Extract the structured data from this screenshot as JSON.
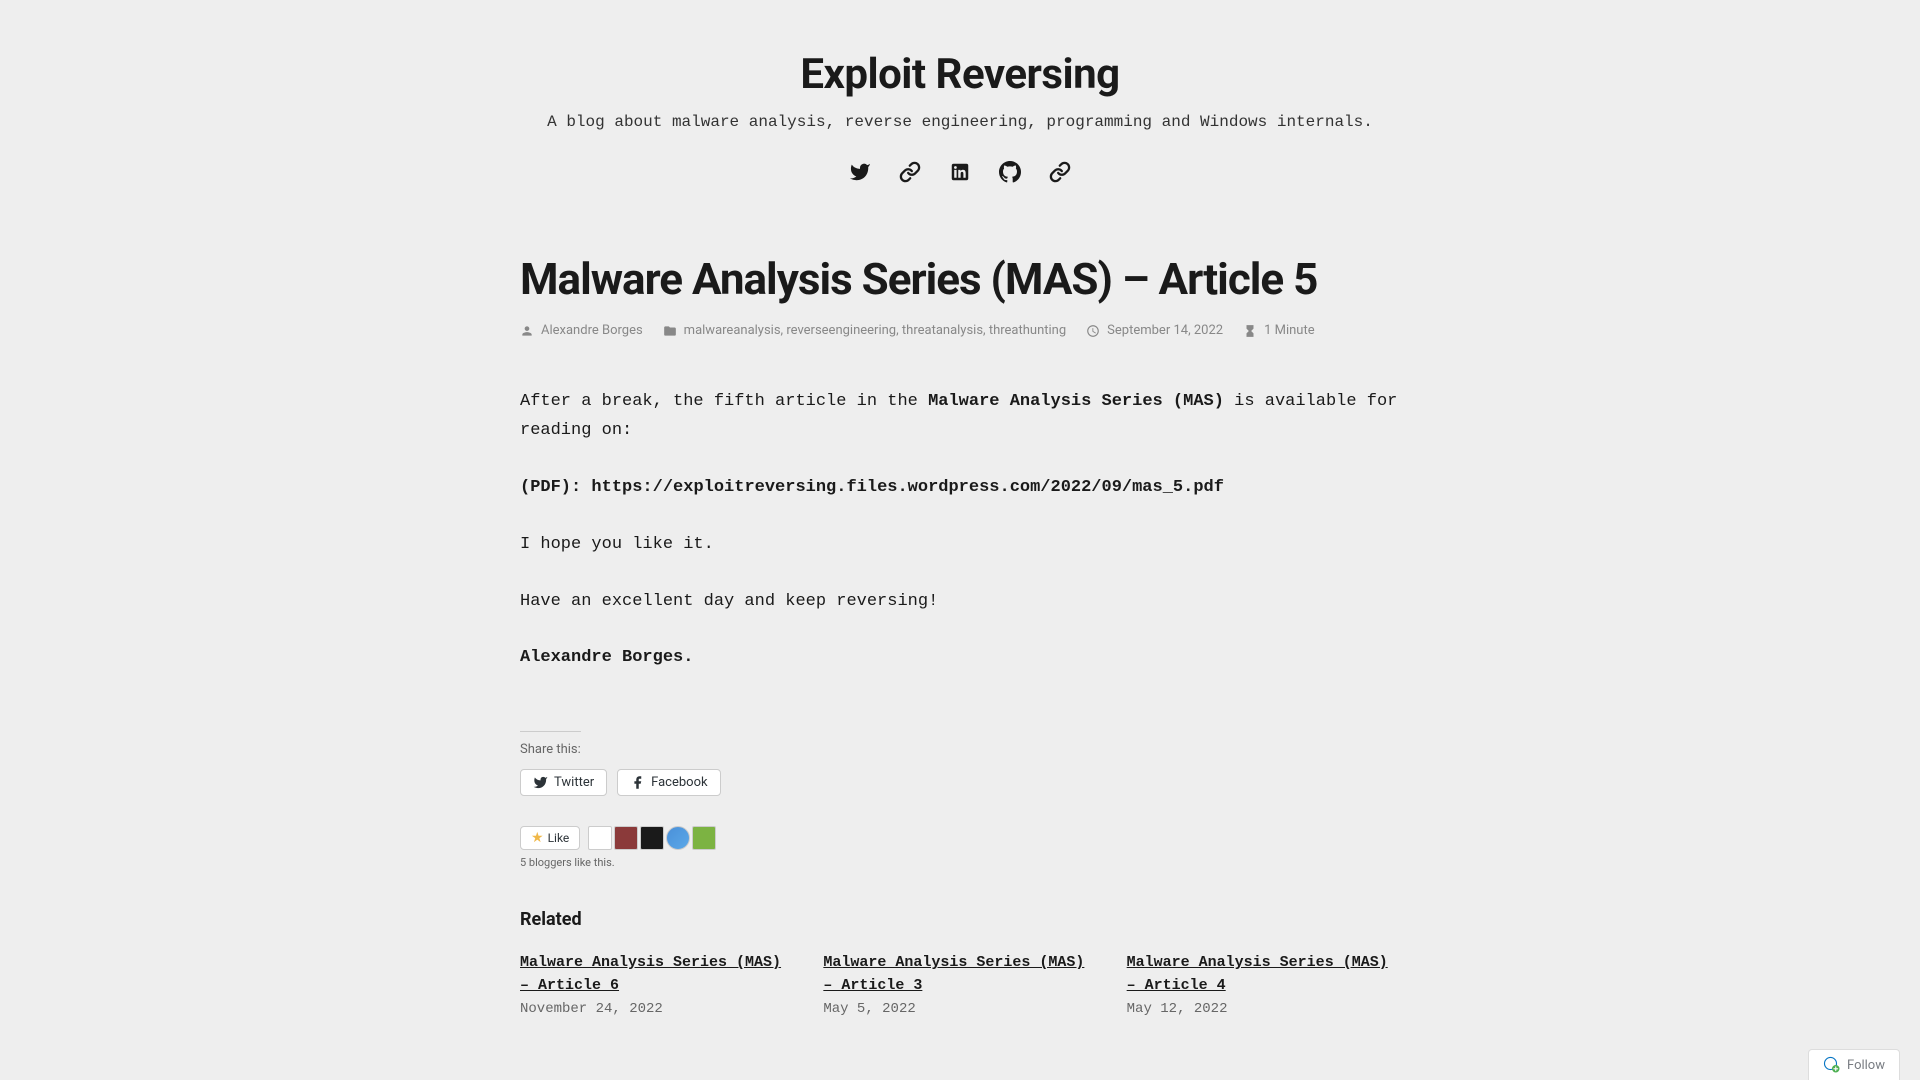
{
  "site": {
    "title": "Exploit Reversing",
    "tagline": "A blog about malware analysis, reverse engineering, programming and Windows internals."
  },
  "post": {
    "title": "Malware Analysis Series (MAS) – Article 5",
    "author": "Alexandre Borges",
    "tags": [
      "malwareanalysis",
      "reverseengineering",
      "threatanalysis",
      "threathunting"
    ],
    "date": "September 14, 2022",
    "read_time": "1 Minute"
  },
  "content": {
    "intro_before": "After a break, the fifth article in the ",
    "intro_bold": "Malware Analysis Series (MAS)",
    "intro_after": " is available for reading on:",
    "pdf_label": "(PDF): ",
    "pdf_url": "https://exploitreversing.files.wordpress.com/2022/09/mas_5.pdf",
    "hope": "I hope you like it.",
    "closing": "Have an excellent day and keep reversing!",
    "signature": "Alexandre Borges."
  },
  "share": {
    "label": "Share this:",
    "twitter": "Twitter",
    "facebook": "Facebook"
  },
  "likes": {
    "button": "Like",
    "text": "5 bloggers like this."
  },
  "related": {
    "title": "Related",
    "items": [
      {
        "title": "Malware Analysis Series (MAS) – Article 6",
        "date": "November 24, 2022"
      },
      {
        "title": "Malware Analysis Series (MAS) – Article 3",
        "date": "May 5, 2022"
      },
      {
        "title": "Malware Analysis Series (MAS) – Article 4",
        "date": "May 12, 2022"
      }
    ]
  },
  "follow": {
    "label": "Follow"
  }
}
